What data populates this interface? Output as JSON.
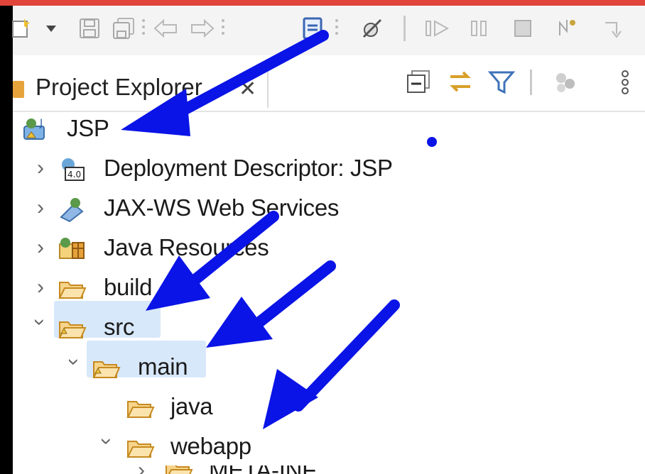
{
  "window": {
    "accent_border_color": "#e0443a",
    "annotation_color": "#0a14e6"
  },
  "toolbar": {
    "icons": [
      "new-wizard-icon",
      "dropdown-icon",
      "save-icon",
      "save-all-icon",
      "undo-icon",
      "redo-icon",
      "open-file-icon",
      "skip-breakpoints-icon",
      "resume-icon",
      "suspend-icon",
      "terminate-icon",
      "disconnect-icon",
      "step-into-icon"
    ]
  },
  "view": {
    "tab_label": "Project Explorer",
    "tab_close": "✕",
    "actions": [
      "collapse-all-icon",
      "link-with-editor-icon",
      "filter-icon",
      "focus-icon",
      "view-menu-icon"
    ]
  },
  "tree": {
    "items": [
      {
        "label": "JSP",
        "icon": "web-project-icon",
        "expanded": true
      },
      {
        "label": "Deployment Descriptor: JSP",
        "icon": "deployment-descriptor-icon",
        "expanded": false
      },
      {
        "label": "JAX-WS Web Services",
        "icon": "web-services-icon",
        "expanded": false
      },
      {
        "label": "Java Resources",
        "icon": "java-resources-icon",
        "expanded": false
      },
      {
        "label": "build",
        "icon": "folder-icon",
        "expanded": false
      },
      {
        "label": "src",
        "icon": "folder-icon",
        "expanded": true
      },
      {
        "label": "main",
        "icon": "folder-icon",
        "expanded": true
      },
      {
        "label": "java",
        "icon": "folder-icon",
        "expanded": null
      },
      {
        "label": "webapp",
        "icon": "folder-icon",
        "expanded": true
      },
      {
        "label": "META-INF",
        "icon": "folder-icon",
        "expanded": false
      }
    ]
  }
}
